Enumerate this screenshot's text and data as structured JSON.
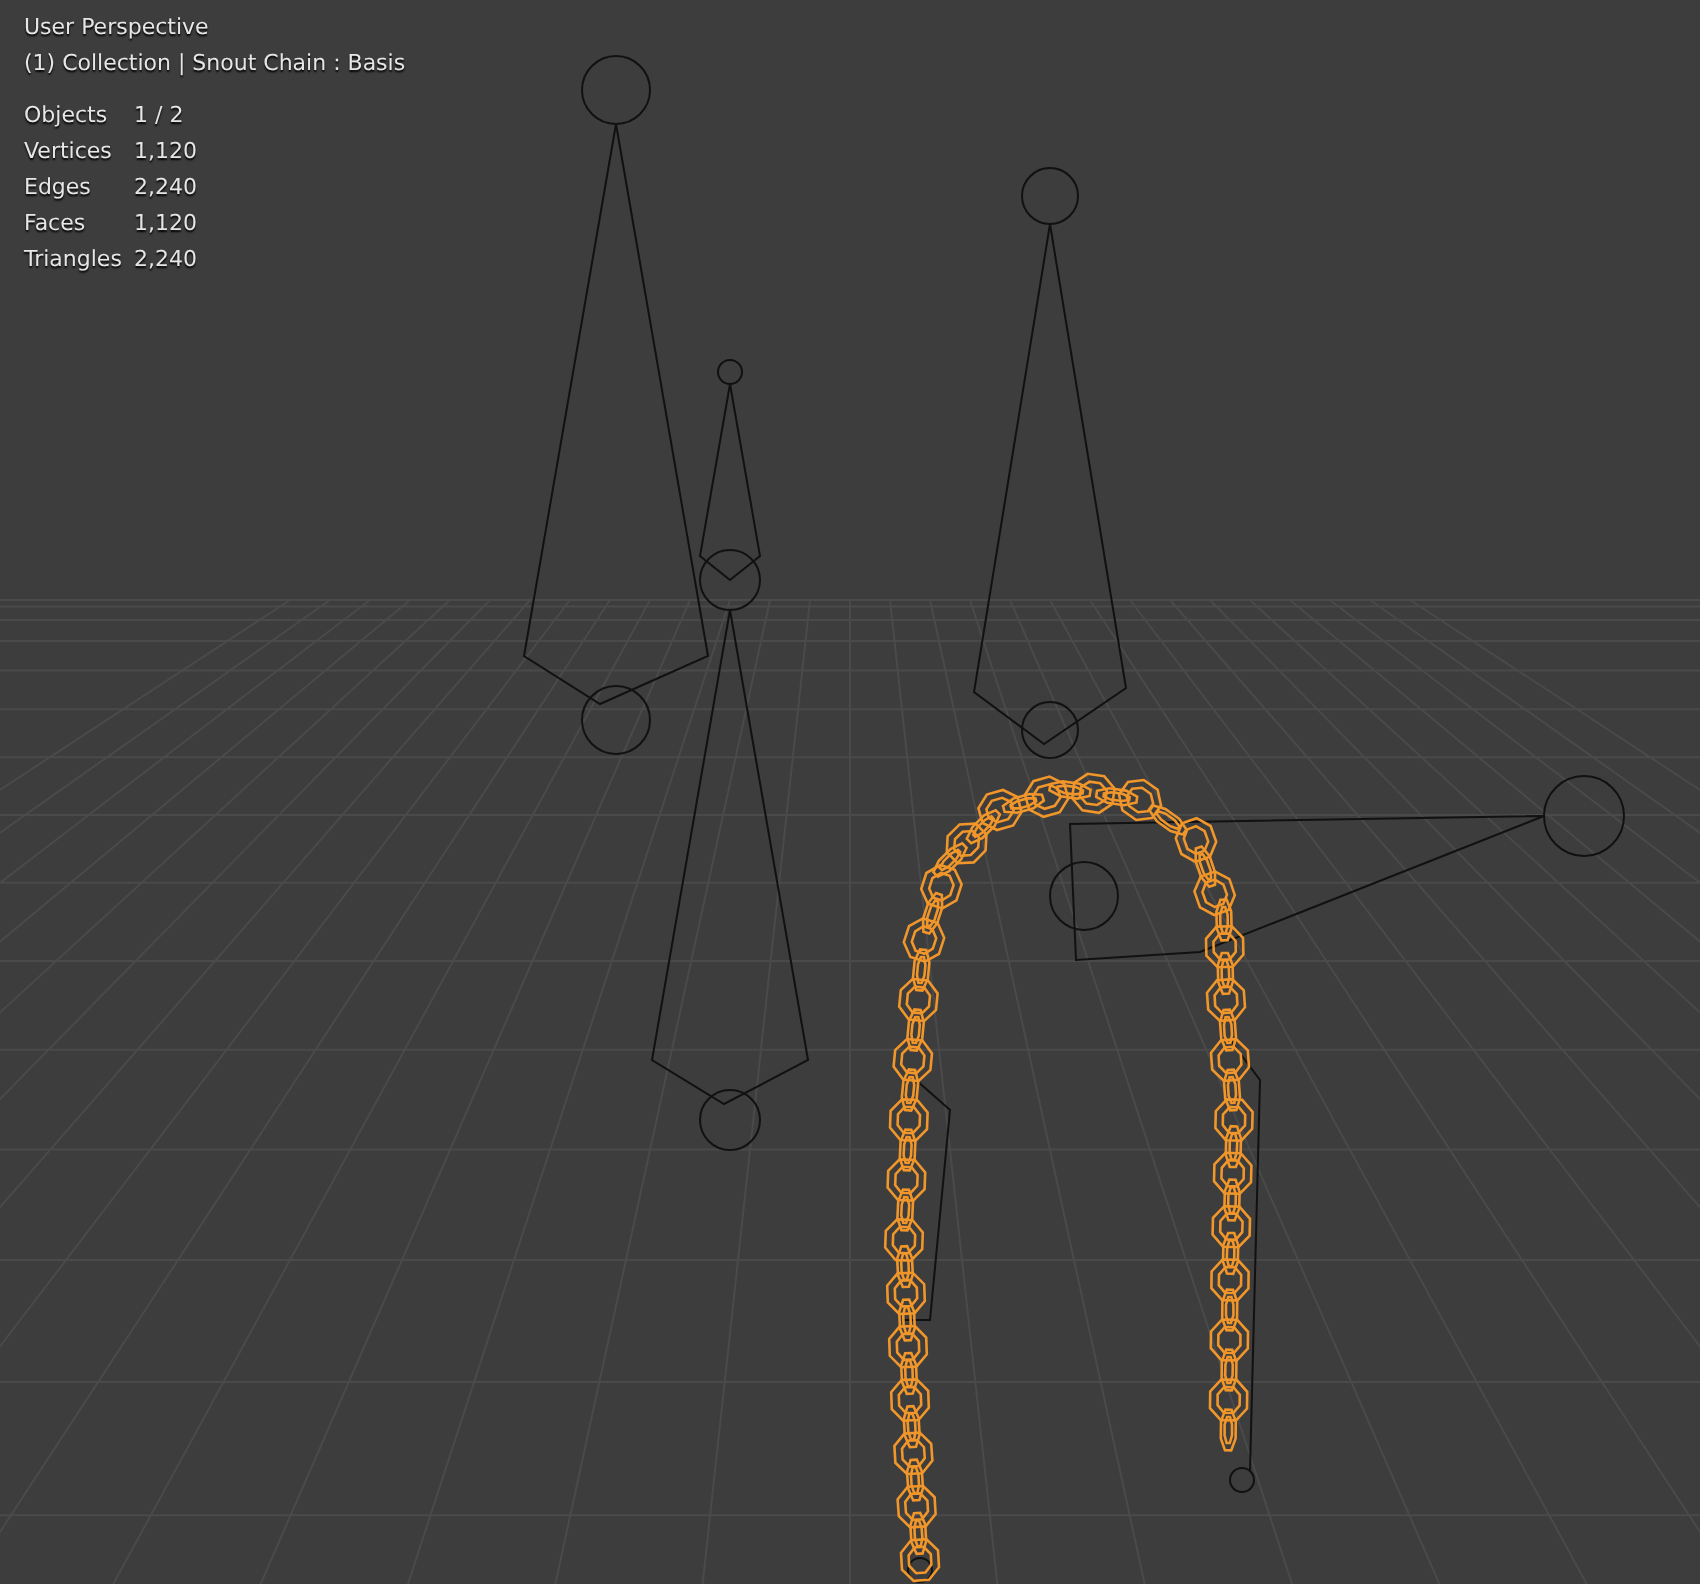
{
  "viewport": {
    "view_name": "User Perspective",
    "object_info": "(1) Collection | Snout Chain : Basis",
    "stats": [
      {
        "label": "Objects",
        "value": "1 / 2"
      },
      {
        "label": "Vertices",
        "value": "1,120"
      },
      {
        "label": "Edges",
        "value": "2,240"
      },
      {
        "label": "Faces",
        "value": "1,120"
      },
      {
        "label": "Triangles",
        "value": "2,240"
      }
    ]
  }
}
